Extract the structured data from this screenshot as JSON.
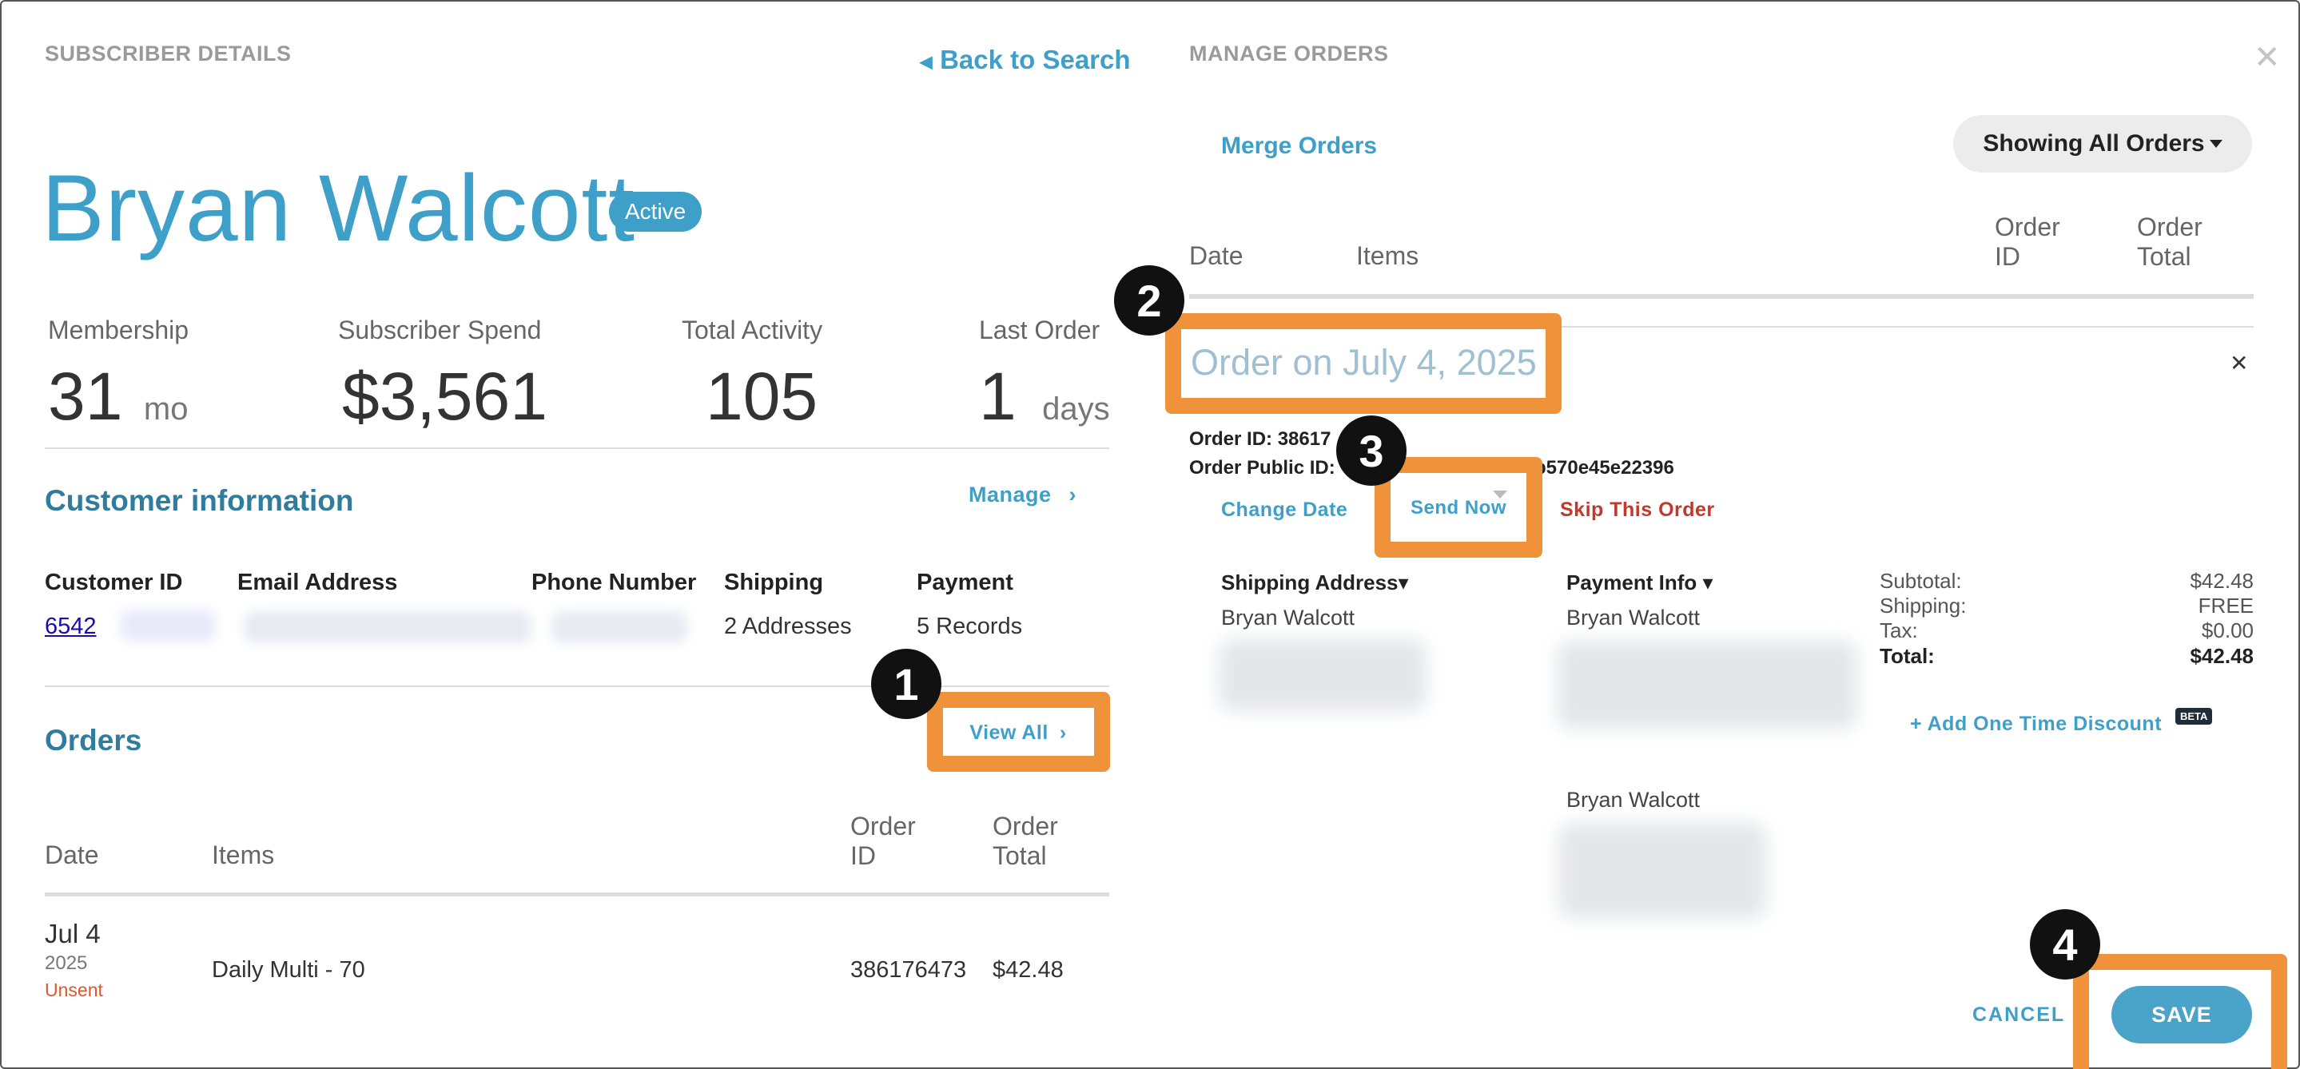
{
  "left": {
    "section_title": "SUBSCRIBER DETAILS",
    "back_link": "Back to Search",
    "name": "Bryan Walcott",
    "status_badge": "Active",
    "stats": [
      {
        "label": "Membership",
        "value": "31",
        "unit": "mo"
      },
      {
        "label": "Subscriber Spend",
        "value": "$3,561",
        "unit": ""
      },
      {
        "label": "Total Activity",
        "value": "105",
        "unit": ""
      },
      {
        "label": "Last Order",
        "value": "1",
        "unit": "days"
      }
    ],
    "customer_info": {
      "heading": "Customer information",
      "manage_link": "Manage",
      "columns": [
        "Customer ID",
        "Email Address",
        "Phone Number",
        "Shipping",
        "Payment"
      ],
      "customer_id": "6542",
      "shipping": "2 Addresses",
      "payment": "5 Records"
    },
    "orders": {
      "heading": "Orders",
      "view_all": "View All",
      "columns": {
        "date": "Date",
        "items": "Items",
        "order_id": "Order ID",
        "order_total": "Order Total"
      },
      "rows": [
        {
          "date": "Jul 4",
          "year": "2025",
          "status": "Unsent",
          "items": "Daily Multi - 70",
          "order_id": "386176473",
          "total": "$42.48"
        }
      ]
    }
  },
  "right": {
    "section_title": "MANAGE ORDERS",
    "merge_orders": "Merge Orders",
    "filter_label": "Showing All Orders",
    "columns": {
      "date": "Date",
      "items": "Items",
      "order_id": "Order ID",
      "order_total": "Order Total"
    },
    "order": {
      "title": "Order on July 4, 2025",
      "order_id_label": "Order ID:",
      "order_id_value": "38617",
      "public_id_label": "Order Public ID:",
      "public_id_visible_tail": "b570e45e22396",
      "change_date": "Change Date",
      "send_now": "Send Now",
      "skip_order": "Skip This Order",
      "shipping_address_label": "Shipping Address",
      "payment_info_label": "Payment Info",
      "shipping_name": "Bryan Walcott",
      "payment_name": "Bryan Walcott",
      "billing_name": "Bryan Walcott",
      "summary": [
        {
          "label": "Subtotal:",
          "value": "$42.48"
        },
        {
          "label": "Shipping:",
          "value": "FREE"
        },
        {
          "label": "Tax:",
          "value": "$0.00"
        },
        {
          "label": "Total:",
          "value": "$42.48"
        }
      ],
      "discount_link": "+ Add One Time Discount",
      "beta_badge": "BETA"
    },
    "cancel": "CANCEL",
    "save": "SAVE"
  },
  "callouts": [
    "1",
    "2",
    "3",
    "4"
  ],
  "colors": {
    "accent": "#3ea0c8",
    "highlight": "#f0923a",
    "danger": "#c0392b",
    "unsent": "#e0562b"
  }
}
